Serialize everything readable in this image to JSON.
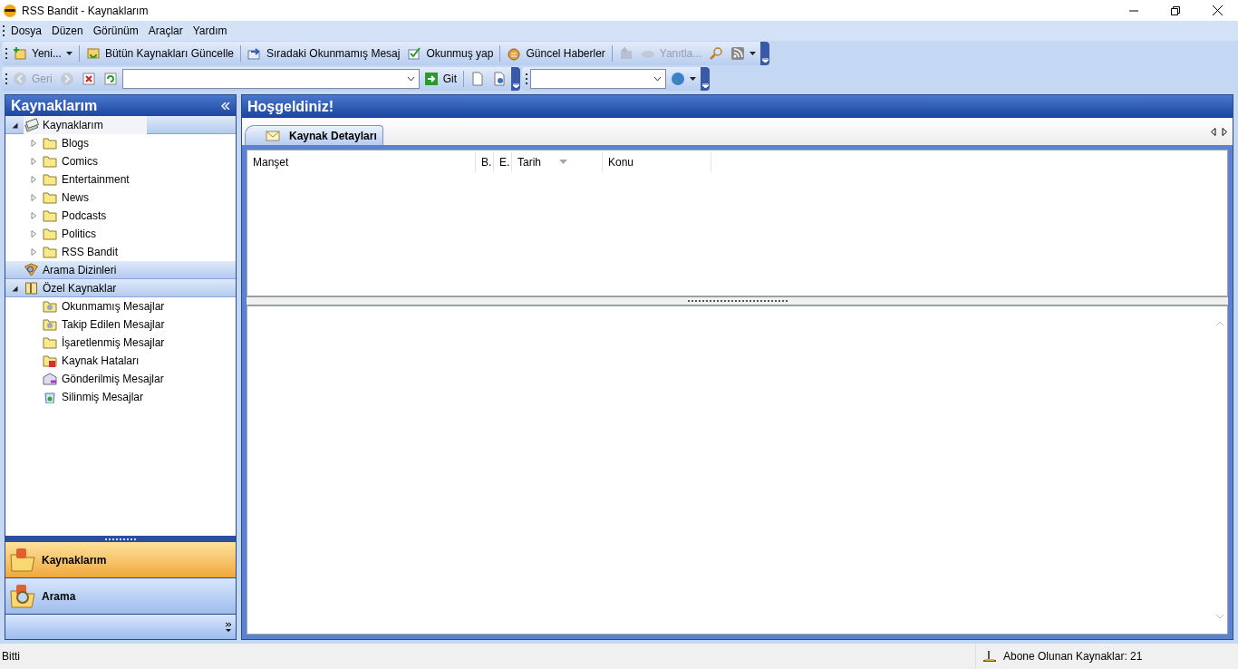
{
  "window": {
    "title": "RSS Bandit - Kaynaklarım"
  },
  "menu": [
    "Dosya",
    "Düzen",
    "Görünüm",
    "Araçlar",
    "Yardım"
  ],
  "toolbar": [
    {
      "kind": "button",
      "label": "Yeni...",
      "disabled": false,
      "dropdown": true
    },
    {
      "kind": "separator"
    },
    {
      "kind": "button",
      "label": "Bütün Kaynakları Güncelle",
      "disabled": false
    },
    {
      "kind": "separator"
    },
    {
      "kind": "button",
      "label": "Sıradaki Okunmamış Mesaj",
      "disabled": false
    },
    {
      "kind": "button",
      "label": "Okunmuş yap",
      "disabled": false
    },
    {
      "kind": "separator"
    },
    {
      "kind": "button",
      "label": "Güncel Haberler",
      "disabled": false
    },
    {
      "kind": "separator"
    },
    {
      "kind": "icon",
      "disabled": true
    },
    {
      "kind": "button",
      "label": "Yanıtla...",
      "disabled": true
    },
    {
      "kind": "icon",
      "disabled": false
    },
    {
      "kind": "icon",
      "disabled": false,
      "dropdown": true
    }
  ],
  "navbar": [
    {
      "kind": "button",
      "label": "Geri",
      "disabled": true
    },
    {
      "kind": "icon",
      "disabled": true
    },
    {
      "kind": "icon",
      "disabled": false
    },
    {
      "kind": "icon",
      "disabled": false
    },
    {
      "kind": "combo"
    },
    {
      "kind": "button",
      "label": "Git",
      "disabled": false
    },
    {
      "kind": "separator"
    },
    {
      "kind": "icon",
      "disabled": false
    },
    {
      "kind": "icon",
      "disabled": false
    }
  ],
  "search_bar": [
    {
      "kind": "combo"
    },
    {
      "kind": "icon",
      "disabled": false,
      "dropdown": true
    }
  ],
  "sidebar": {
    "title": "Kaynaklarım",
    "sections": [
      {
        "label": "Kaynaklarım",
        "expanded": true,
        "selected": true,
        "children": [
          {
            "label": "Blogs",
            "expanded": false
          },
          {
            "label": "Comics",
            "expanded": false
          },
          {
            "label": "Entertainment",
            "expanded": false
          },
          {
            "label": "News",
            "expanded": false
          },
          {
            "label": "Podcasts",
            "expanded": false
          },
          {
            "label": "Politics",
            "expanded": false
          },
          {
            "label": "RSS Bandit",
            "expanded": false
          }
        ]
      },
      {
        "label": "Arama Dizinleri",
        "selected": false
      },
      {
        "label": "Özel Kaynaklar",
        "expanded": true,
        "selected": false,
        "children": [
          {
            "label": "Okunmamış Mesajlar"
          },
          {
            "label": "Takip Edilen Mesajlar"
          },
          {
            "label": "İşaretlenmiş Mesajlar"
          },
          {
            "label": "Kaynak Hataları"
          },
          {
            "label": "Gönderilmiş Mesajlar"
          },
          {
            "label": "Silinmiş Mesajlar"
          }
        ]
      }
    ],
    "nav_buttons": [
      {
        "label": "Kaynaklarım",
        "selected": true
      },
      {
        "label": "Arama",
        "selected": false
      }
    ]
  },
  "main": {
    "title": "Hoşgeldiniz!",
    "tabs": [
      {
        "label": "Kaynak Detayları",
        "selected": true
      }
    ],
    "columns": [
      {
        "label": "Manşet"
      },
      {
        "label": "B."
      },
      {
        "label": "E."
      },
      {
        "label": "Tarih",
        "sorted": true
      },
      {
        "label": "Konu"
      }
    ]
  },
  "status_bar": {
    "text": "Bitti",
    "feeds": "Abone Olunan Kaynaklar: 21"
  }
}
